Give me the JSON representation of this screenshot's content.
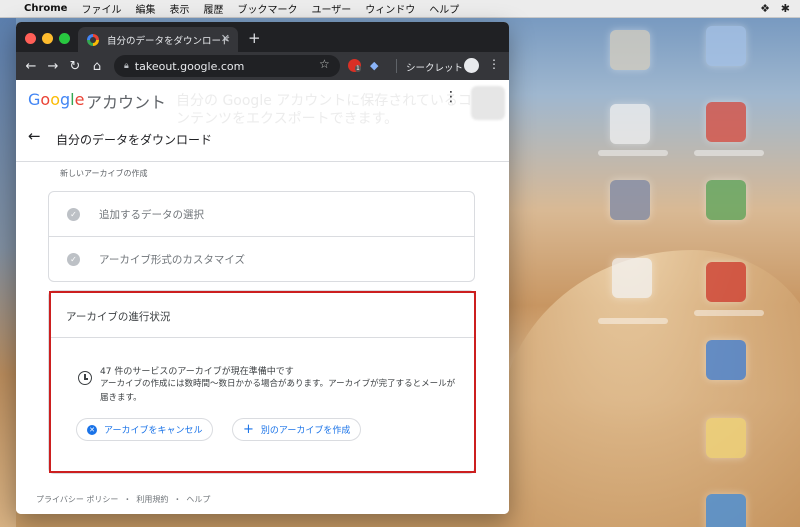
{
  "menubar": {
    "app": "Chrome",
    "items": [
      "ファイル",
      "編集",
      "表示",
      "履歴",
      "ブックマーク",
      "ユーザー",
      "ウィンドウ",
      "ヘルプ"
    ]
  },
  "browser": {
    "tab_title": "自分のデータをダウンロード",
    "url": "takeout.google.com",
    "incognito_label": "シークレット",
    "extension_badge": "1"
  },
  "header": {
    "logo": "Google",
    "account_label": "アカウント",
    "ghost_text": "自分の Google アカウントに保存されているコンテンツをエクスポートできます。",
    "page_title": "自分のデータをダウンロード"
  },
  "section_label": "新しいアーカイブの作成",
  "steps": [
    {
      "label": "追加するデータの選択"
    },
    {
      "label": "アーカイブ形式のカスタマイズ"
    }
  ],
  "progress": {
    "title": "アーカイブの進行状況",
    "message": "47 件のサービスのアーカイブが現在準備中です",
    "sub": "アーカイブの作成には数時間〜数日かかる場合があります。アーカイブが完了するとメールが届きます。",
    "cancel_label": "アーカイブをキャンセル",
    "new_label": "別のアーカイブを作成"
  },
  "footer": {
    "privacy": "プライバシー ポリシー",
    "terms": "利用規約",
    "help": "ヘルプ",
    "separator": "・"
  },
  "colors": {
    "accent": "#1a73e8",
    "highlight_border": "#cc1f1f",
    "check_gray": "#bdc1c6"
  }
}
